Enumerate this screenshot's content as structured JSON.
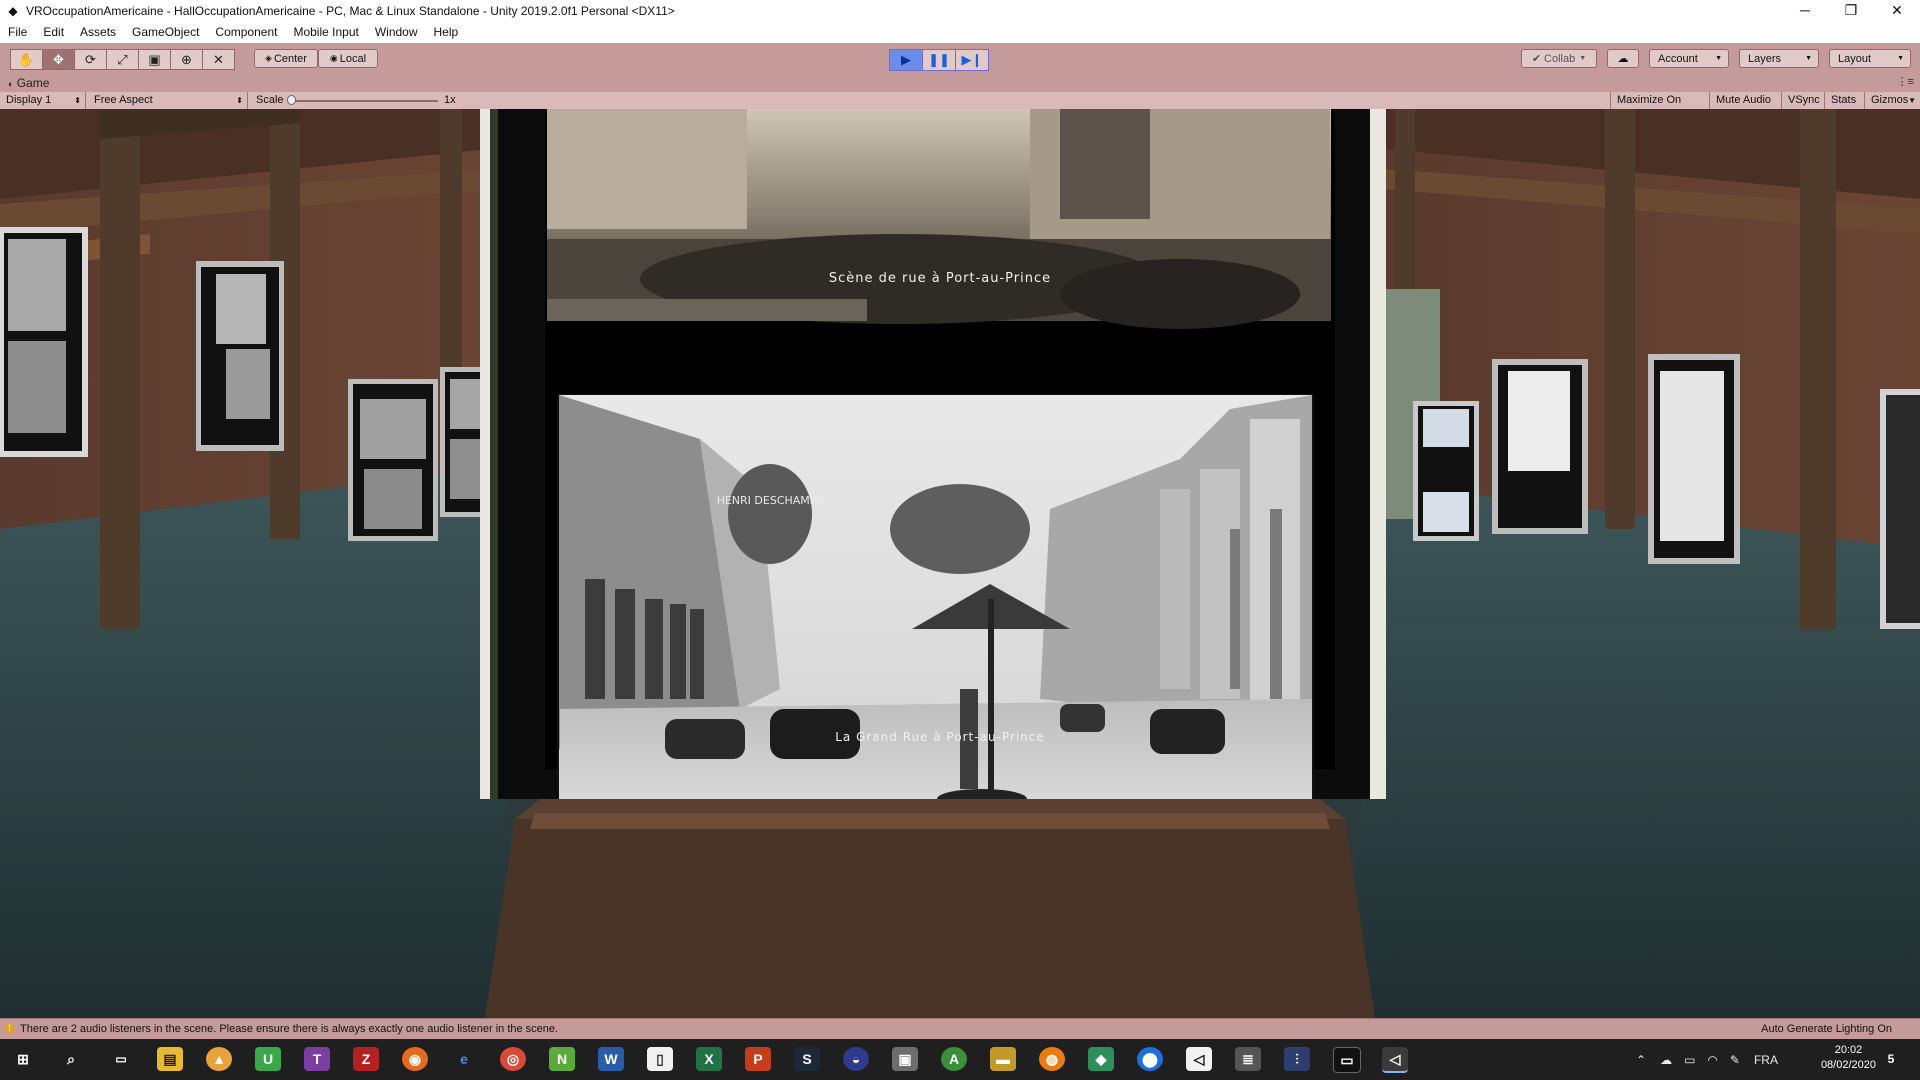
{
  "window": {
    "title": "VROccupationAmericaine - HallOccupationAmericaine - PC, Mac & Linux Standalone - Unity 2019.2.0f1 Personal <DX11>",
    "controls": [
      "─",
      "❐",
      "✕"
    ]
  },
  "menu": [
    "File",
    "Edit",
    "Assets",
    "GameObject",
    "Component",
    "Mobile Input",
    "Window",
    "Help"
  ],
  "toolbar": {
    "tools": [
      "hand-tool-icon",
      "move-tool-icon",
      "rotate-tool-icon",
      "scale-tool-icon",
      "rect-tool-icon",
      "transform-tool-icon",
      "custom-tool-icon"
    ],
    "pivot_label": "Center",
    "space_label": "Local",
    "collab_label": "Collab",
    "account_label": "Account",
    "layers_label": "Layers",
    "layout_label": "Layout"
  },
  "game_tab": {
    "label": "Game"
  },
  "game_toolbar": {
    "display": "Display 1",
    "aspect": "Free Aspect",
    "scale_label": "Scale",
    "scale_value": "1x",
    "maximize": "Maximize On Play",
    "mute": "Mute Audio",
    "vsync": "VSync",
    "stats": "Stats",
    "gizmos": "Gizmos"
  },
  "scene": {
    "caption_top": "Scène de rue à Port-au-Prince",
    "caption_bottom": "La Grand Rue à Port-au-Prince",
    "sign_text": "HENRI DESCHAMPS"
  },
  "status": {
    "message": "There are 2 audio listeners in the scene. Please ensure there is always exactly one audio listener in the scene.",
    "right": "Auto Generate Lighting On"
  },
  "taskbar": {
    "language": "FRA",
    "time": "20:02",
    "date": "08/02/2020",
    "notification_count": "5"
  },
  "colors": {
    "editor_tint": "#c59a9a",
    "play_active": "#6c8ee8",
    "taskbar": "#1f1f1f"
  }
}
